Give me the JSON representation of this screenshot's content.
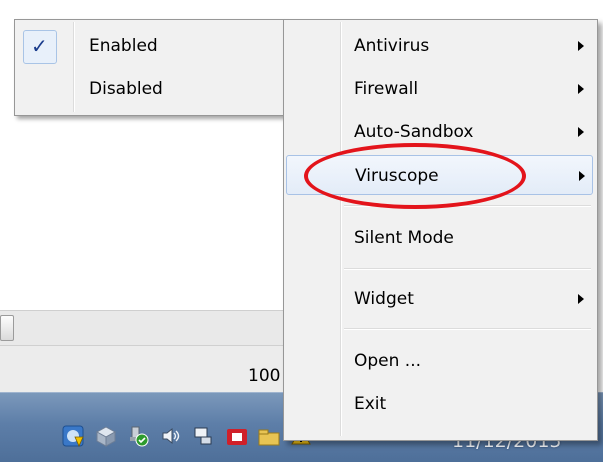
{
  "background_window": {
    "zoom_readout": "100"
  },
  "taskbar": {
    "clock": "11/12/2015",
    "tray_icons": [
      {
        "name": "security-shield-icon"
      },
      {
        "name": "virtual-box-icon"
      },
      {
        "name": "usb-device-icon"
      },
      {
        "name": "volume-icon"
      },
      {
        "name": "network-icon"
      },
      {
        "name": "red-app-icon"
      },
      {
        "name": "folder-icon"
      },
      {
        "name": "warning-flag-icon"
      }
    ]
  },
  "submenu": {
    "items": [
      {
        "label": "Enabled",
        "checked": true
      },
      {
        "label": "Disabled",
        "checked": false
      }
    ]
  },
  "context_menu": {
    "items": [
      {
        "label": "Antivirus",
        "has_submenu": true
      },
      {
        "label": "Firewall",
        "has_submenu": true
      },
      {
        "label": "Auto-Sandbox",
        "has_submenu": true
      },
      {
        "label": "Viruscope",
        "has_submenu": true,
        "highlighted": true
      },
      {
        "label": "Silent Mode",
        "has_submenu": false
      },
      {
        "label": "Widget",
        "has_submenu": true
      },
      {
        "label": "Open ...",
        "has_submenu": false
      },
      {
        "label": "Exit",
        "has_submenu": false
      }
    ]
  },
  "annotation": {
    "color": "#e3141b"
  }
}
